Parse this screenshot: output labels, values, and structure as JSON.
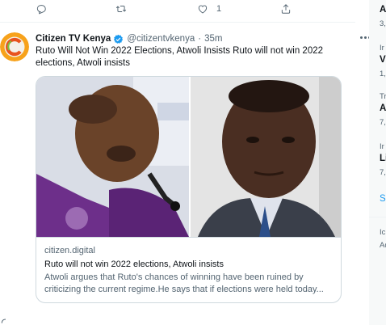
{
  "previous_tweet_actions": {
    "like_count": "1"
  },
  "tweet": {
    "author_name": "Citizen TV Kenya",
    "author_handle": "@citizentvkenya",
    "separator": "·",
    "time": "35m",
    "text": "Ruto Will Not Win 2022 Elections, Atwoli Insists Ruto will not win 2022 elections, Atwoli insists"
  },
  "card": {
    "domain": "citizen.digital",
    "title": "Ruto will not win 2022 elections, Atwoli insists",
    "description": "Atwoli argues that Ruto's chances of winning have been ruined by criticizing the current regime.He says that if elections were held today..."
  },
  "right_sidebar": {
    "items": [
      {
        "top": "A",
        "sub": "3,"
      },
      {
        "top": "Ir",
        "title": "V",
        "sub": "1,"
      },
      {
        "top": "Tr",
        "title": "A",
        "sub": "7,"
      },
      {
        "top": "Ir",
        "title": "Li",
        "sub": "7,"
      }
    ],
    "show_more": "S",
    "footer_1": "Ic",
    "footer_2": "Ad"
  },
  "colors": {
    "accent": "#1d9bf0",
    "secondary_text": "#536471",
    "border": "#cfd9de"
  }
}
